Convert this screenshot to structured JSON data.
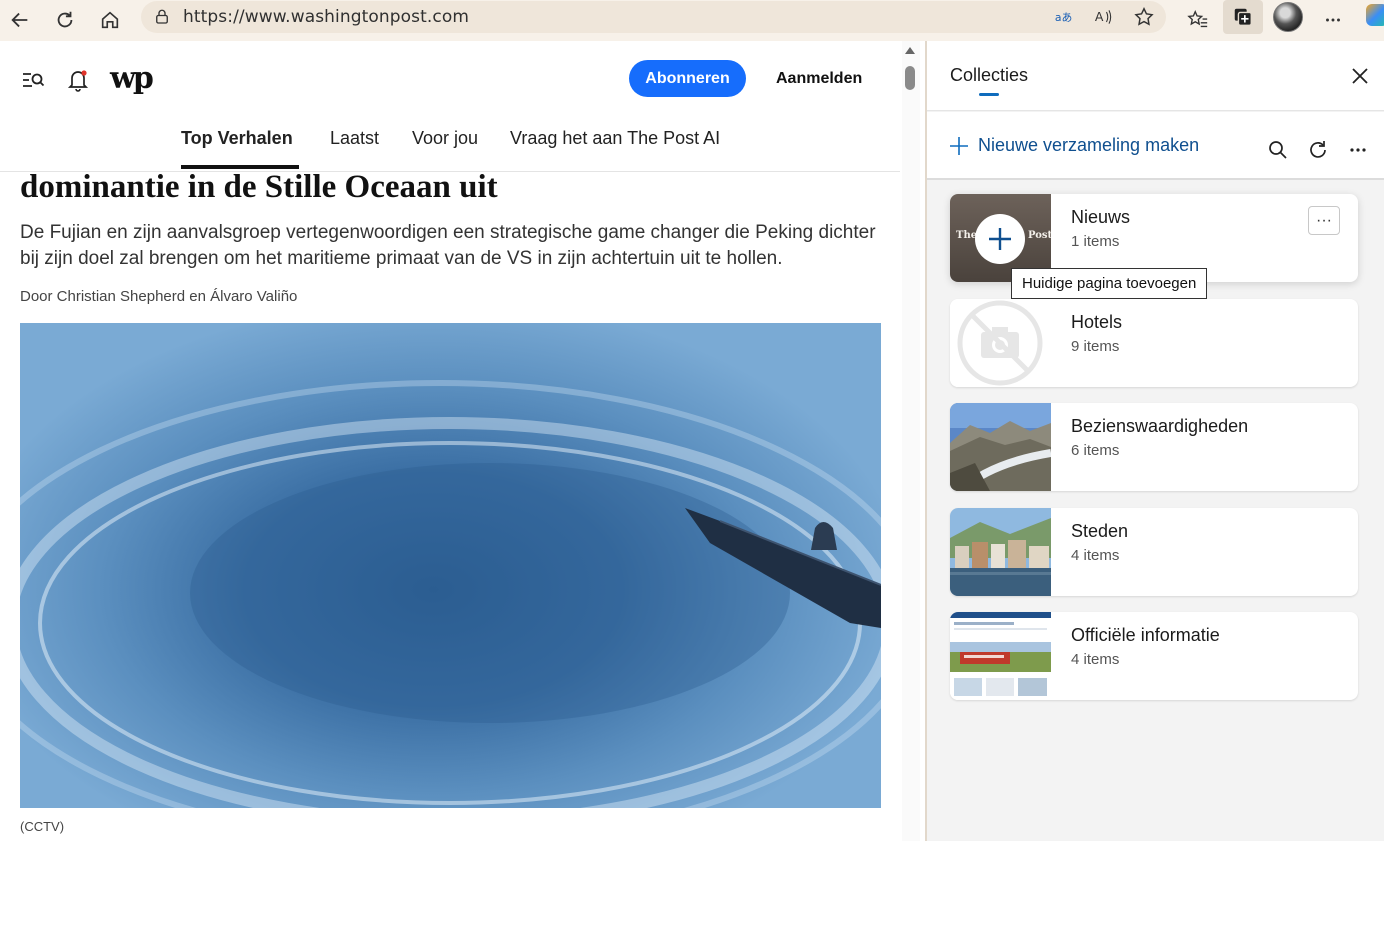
{
  "browser": {
    "url": "https://www.washingtonpost.com"
  },
  "site": {
    "logo": "wp",
    "subscribe_label": "Abonneren",
    "signin_label": "Aanmelden",
    "nav": [
      "Top Verhalen",
      "Laatst",
      "Voor jou",
      "Vraag het aan The Post AI"
    ],
    "active_nav": "Top Verhalen"
  },
  "article": {
    "headline": "dominantie in de Stille Oceaan uit",
    "dek": "De Fujian en zijn aanvalsgroep vertegenwoordigen een strategische game changer die Peking dichter bij zijn doel zal brengen om het maritieme primaat van de VS in zijn achtertuin uit te hollen.",
    "byline": "Door Christian Shepherd en Álvaro Valiño",
    "caption": "(CCTV)"
  },
  "collections_panel": {
    "title": "Collecties",
    "new_collection_label": "Nieuwe verzameling maken",
    "more_label": "···",
    "tooltip": "Huidige pagina toevoegen",
    "collections": [
      {
        "name": "Nieuws",
        "count": "1 items"
      },
      {
        "name": "Hotels",
        "count": "9 items"
      },
      {
        "name": "Bezienswaardigheden",
        "count": "6 items"
      },
      {
        "name": "Steden",
        "count": "4 items"
      },
      {
        "name": "Officiële informatie",
        "count": "4 items"
      }
    ]
  },
  "colors": {
    "subscribe_blue": "#166dfc",
    "collections_accent": "#0f6cbd",
    "toolbar_bg": "#f7f1e9"
  }
}
